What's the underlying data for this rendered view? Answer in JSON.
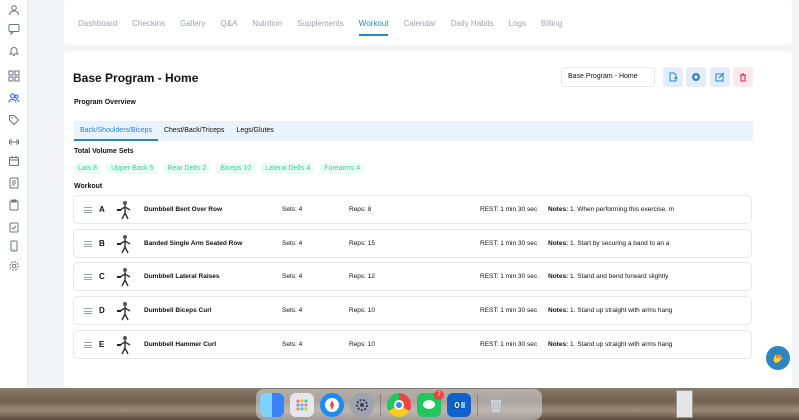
{
  "tabs": [
    "Dashboard",
    "Checkins",
    "Gallery",
    "Q&A",
    "Nutrition",
    "Supplements",
    "Workout",
    "Calendar",
    "Daily Habits",
    "Logs",
    "Billing"
  ],
  "active_tab": "Workout",
  "page_title": "Base Program - Home",
  "program_select": "Base Program - Home",
  "program_overview_label": "Program Overview",
  "subtabs": [
    "Back/Shoulders/Biceps",
    "Chest/Back/Triceps",
    "Legs/Glutes"
  ],
  "active_subtab": "Back/Shoulders/Biceps",
  "total_volume_label": "Total Volume Sets",
  "volume_chips": [
    "Lats 8",
    "Upper Back 5",
    "Rear Delts 2",
    "Biceps 10",
    "Lateral Delts 4",
    "Forearms 4"
  ],
  "workout_label": "Workout",
  "exercises": [
    {
      "letter": "A",
      "name": "Dumbbell Bent Over Row",
      "sets": "Sets: 4",
      "reps": "Reps: 8",
      "rest": "REST: 1 min 30 sec",
      "notes_label": "Notes:",
      "notes": "1. When performing this exercise, m"
    },
    {
      "letter": "B",
      "name": "Banded Single Arm Seated Row",
      "sets": "Sets: 4",
      "reps": "Reps: 15",
      "rest": "REST: 1 min 30 sec",
      "notes_label": "Notes:",
      "notes": "1. Start by securing a band to an a"
    },
    {
      "letter": "C",
      "name": "Dumbbell Lateral Raises",
      "sets": "Sets: 4",
      "reps": "Reps: 12",
      "rest": "REST: 1 min 30 sec",
      "notes_label": "Notes:",
      "notes": "1. Stand and bend forward slightly"
    },
    {
      "letter": "D",
      "name": "Dumbbell Biceps Curl",
      "sets": "Sets: 4",
      "reps": "Reps: 10",
      "rest": "REST: 1 min 30 sec",
      "notes_label": "Notes:",
      "notes": "1. Stand up straight with arms hang"
    },
    {
      "letter": "E",
      "name": "Dumbbell Hammer Curl",
      "sets": "Sets: 4",
      "reps": "Reps: 10",
      "rest": "REST: 1 min 30 sec",
      "notes_label": "Notes:",
      "notes": "1. Stand up straight with arms hang"
    }
  ],
  "dock": {
    "messages_badge": "7"
  },
  "colors": {
    "accent": "#2b86c5",
    "chip_text": "#34d399",
    "danger": "#e11d48"
  },
  "icons": {
    "sidebar": [
      "user-icon",
      "chat-icon",
      "bell-icon",
      "grid-icon",
      "users-icon",
      "tag-icon",
      "dumbbell-icon",
      "calendar-icon",
      "document-icon",
      "clipboard-icon",
      "check-clipboard-icon",
      "phone-icon",
      "gear-icon"
    ],
    "toolbar": [
      "export-icon",
      "add-icon",
      "edit-icon",
      "trash-icon"
    ],
    "dock": [
      "finder-icon",
      "launchpad-icon",
      "safari-icon",
      "settings-icon",
      "chrome-icon",
      "messages-icon",
      "outlook-icon",
      "trash-icon"
    ]
  }
}
